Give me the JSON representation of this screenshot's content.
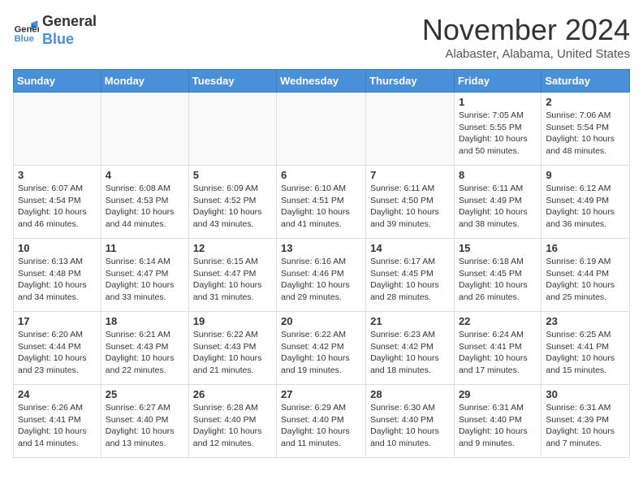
{
  "header": {
    "logo_line1": "General",
    "logo_line2": "Blue",
    "month": "November 2024",
    "location": "Alabaster, Alabama, United States"
  },
  "weekdays": [
    "Sunday",
    "Monday",
    "Tuesday",
    "Wednesday",
    "Thursday",
    "Friday",
    "Saturday"
  ],
  "weeks": [
    [
      {
        "day": "",
        "info": ""
      },
      {
        "day": "",
        "info": ""
      },
      {
        "day": "",
        "info": ""
      },
      {
        "day": "",
        "info": ""
      },
      {
        "day": "",
        "info": ""
      },
      {
        "day": "1",
        "info": "Sunrise: 7:05 AM\nSunset: 5:55 PM\nDaylight: 10 hours\nand 50 minutes."
      },
      {
        "day": "2",
        "info": "Sunrise: 7:06 AM\nSunset: 5:54 PM\nDaylight: 10 hours\nand 48 minutes."
      }
    ],
    [
      {
        "day": "3",
        "info": "Sunrise: 6:07 AM\nSunset: 4:54 PM\nDaylight: 10 hours\nand 46 minutes."
      },
      {
        "day": "4",
        "info": "Sunrise: 6:08 AM\nSunset: 4:53 PM\nDaylight: 10 hours\nand 44 minutes."
      },
      {
        "day": "5",
        "info": "Sunrise: 6:09 AM\nSunset: 4:52 PM\nDaylight: 10 hours\nand 43 minutes."
      },
      {
        "day": "6",
        "info": "Sunrise: 6:10 AM\nSunset: 4:51 PM\nDaylight: 10 hours\nand 41 minutes."
      },
      {
        "day": "7",
        "info": "Sunrise: 6:11 AM\nSunset: 4:50 PM\nDaylight: 10 hours\nand 39 minutes."
      },
      {
        "day": "8",
        "info": "Sunrise: 6:11 AM\nSunset: 4:49 PM\nDaylight: 10 hours\nand 38 minutes."
      },
      {
        "day": "9",
        "info": "Sunrise: 6:12 AM\nSunset: 4:49 PM\nDaylight: 10 hours\nand 36 minutes."
      }
    ],
    [
      {
        "day": "10",
        "info": "Sunrise: 6:13 AM\nSunset: 4:48 PM\nDaylight: 10 hours\nand 34 minutes."
      },
      {
        "day": "11",
        "info": "Sunrise: 6:14 AM\nSunset: 4:47 PM\nDaylight: 10 hours\nand 33 minutes."
      },
      {
        "day": "12",
        "info": "Sunrise: 6:15 AM\nSunset: 4:47 PM\nDaylight: 10 hours\nand 31 minutes."
      },
      {
        "day": "13",
        "info": "Sunrise: 6:16 AM\nSunset: 4:46 PM\nDaylight: 10 hours\nand 29 minutes."
      },
      {
        "day": "14",
        "info": "Sunrise: 6:17 AM\nSunset: 4:45 PM\nDaylight: 10 hours\nand 28 minutes."
      },
      {
        "day": "15",
        "info": "Sunrise: 6:18 AM\nSunset: 4:45 PM\nDaylight: 10 hours\nand 26 minutes."
      },
      {
        "day": "16",
        "info": "Sunrise: 6:19 AM\nSunset: 4:44 PM\nDaylight: 10 hours\nand 25 minutes."
      }
    ],
    [
      {
        "day": "17",
        "info": "Sunrise: 6:20 AM\nSunset: 4:44 PM\nDaylight: 10 hours\nand 23 minutes."
      },
      {
        "day": "18",
        "info": "Sunrise: 6:21 AM\nSunset: 4:43 PM\nDaylight: 10 hours\nand 22 minutes."
      },
      {
        "day": "19",
        "info": "Sunrise: 6:22 AM\nSunset: 4:43 PM\nDaylight: 10 hours\nand 21 minutes."
      },
      {
        "day": "20",
        "info": "Sunrise: 6:22 AM\nSunset: 4:42 PM\nDaylight: 10 hours\nand 19 minutes."
      },
      {
        "day": "21",
        "info": "Sunrise: 6:23 AM\nSunset: 4:42 PM\nDaylight: 10 hours\nand 18 minutes."
      },
      {
        "day": "22",
        "info": "Sunrise: 6:24 AM\nSunset: 4:41 PM\nDaylight: 10 hours\nand 17 minutes."
      },
      {
        "day": "23",
        "info": "Sunrise: 6:25 AM\nSunset: 4:41 PM\nDaylight: 10 hours\nand 15 minutes."
      }
    ],
    [
      {
        "day": "24",
        "info": "Sunrise: 6:26 AM\nSunset: 4:41 PM\nDaylight: 10 hours\nand 14 minutes."
      },
      {
        "day": "25",
        "info": "Sunrise: 6:27 AM\nSunset: 4:40 PM\nDaylight: 10 hours\nand 13 minutes."
      },
      {
        "day": "26",
        "info": "Sunrise: 6:28 AM\nSunset: 4:40 PM\nDaylight: 10 hours\nand 12 minutes."
      },
      {
        "day": "27",
        "info": "Sunrise: 6:29 AM\nSunset: 4:40 PM\nDaylight: 10 hours\nand 11 minutes."
      },
      {
        "day": "28",
        "info": "Sunrise: 6:30 AM\nSunset: 4:40 PM\nDaylight: 10 hours\nand 10 minutes."
      },
      {
        "day": "29",
        "info": "Sunrise: 6:31 AM\nSunset: 4:40 PM\nDaylight: 10 hours\nand 9 minutes."
      },
      {
        "day": "30",
        "info": "Sunrise: 6:31 AM\nSunset: 4:39 PM\nDaylight: 10 hours\nand 7 minutes."
      }
    ]
  ]
}
